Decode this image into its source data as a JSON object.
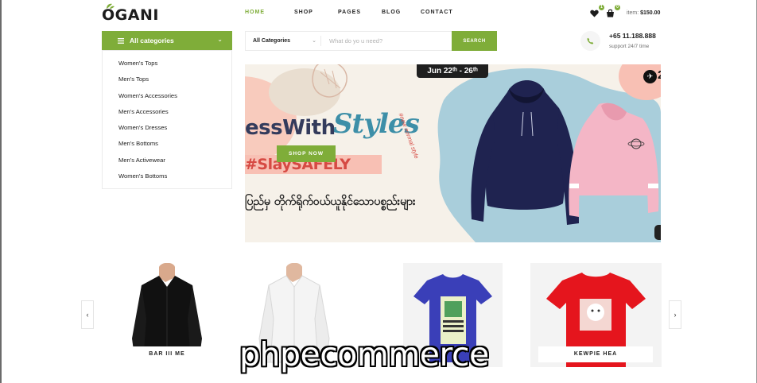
{
  "brand": {
    "name": "OGANI",
    "accent": "#7fad39"
  },
  "nav": {
    "home": "HOME",
    "shop": "SHOP",
    "pages": "PAGES",
    "blog": "BLOG",
    "contact": "CONTACT"
  },
  "header": {
    "wishlist_count": "1",
    "cart_count": "0",
    "item_label": "item:",
    "item_total": "$150.00"
  },
  "categories": {
    "title": "All categories",
    "items": [
      "Women's Tops",
      "Men's Tops",
      "Women's Accessories",
      "Men's Accessories",
      "Women's Dresses",
      "Men's Bottoms",
      "Men's Activewear",
      "Women's Bottoms"
    ]
  },
  "search": {
    "category": "All Categories",
    "placeholder": "What do yo u need?",
    "button": "SEARCH"
  },
  "support": {
    "phone": "+65 11.188.888",
    "text": "support 24/7 time"
  },
  "hero": {
    "date": "Jun 22ᵗʰ - 26ᵗʰ",
    "headline": "essWith",
    "script": "Styles",
    "hashtag": "#SlaySAFELY",
    "new_normal": "#new normal style",
    "button": "SHOP NOW",
    "burmese": "ပြည်မှ တိုက်ရိုက်ဝယ်ယူနိုင်သောပစ္စည်းများ"
  },
  "products": [
    {
      "label": "BAR III ME"
    },
    {
      "label": ""
    },
    {
      "label": ""
    },
    {
      "label": "KEWPIE HEA"
    }
  ],
  "watermark": "phpecommerce",
  "icons": [
    "heart-icon",
    "bag-icon",
    "menu-icon",
    "chevron-down-icon",
    "phone-icon",
    "plane-icon",
    "arrow-left-icon",
    "arrow-right-icon"
  ]
}
